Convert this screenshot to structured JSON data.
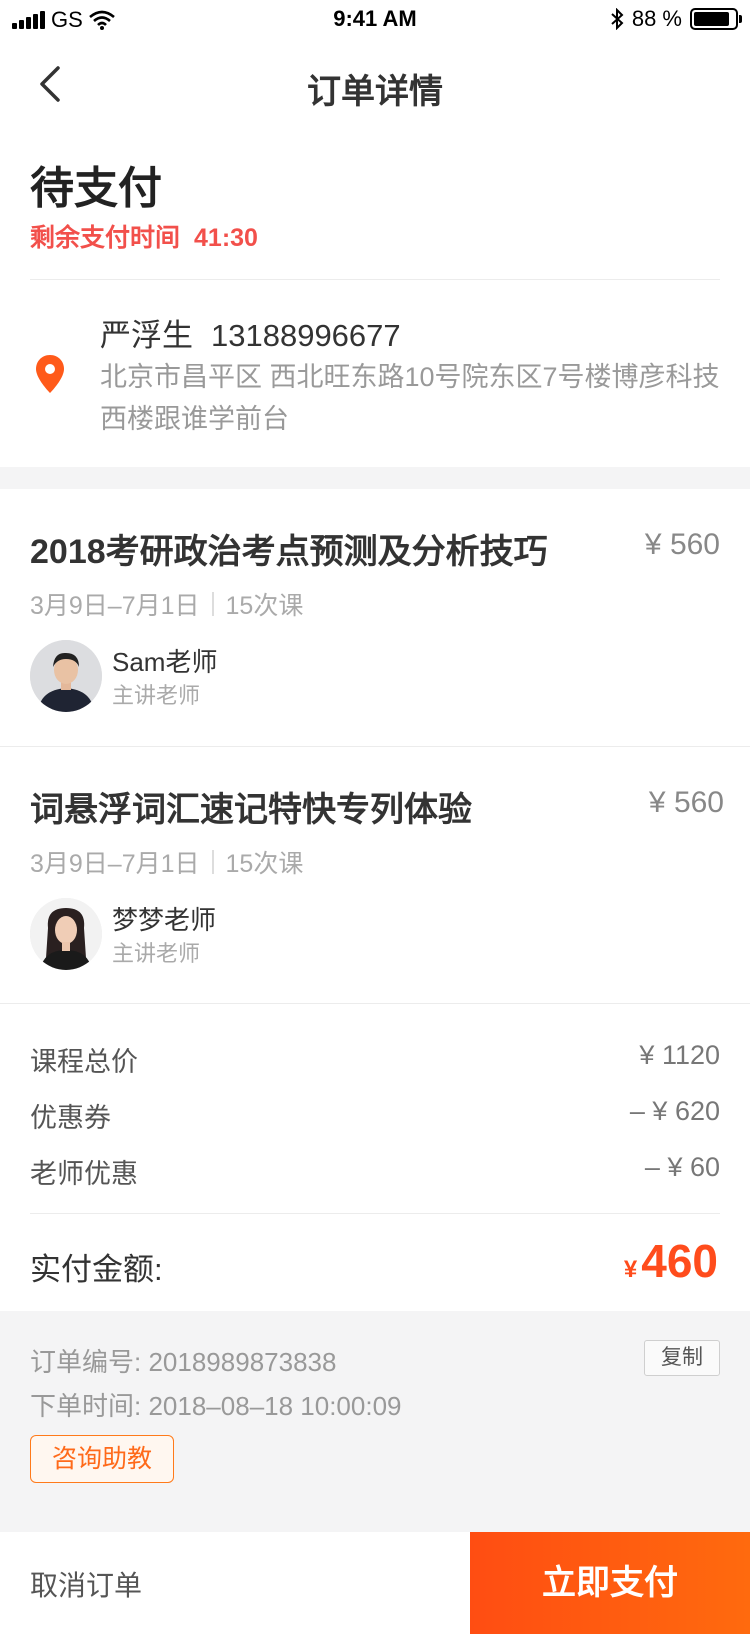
{
  "status_bar": {
    "carrier": "GS",
    "time": "9:41 AM",
    "battery": "88 %",
    "battery_level": 0.88
  },
  "nav": {
    "title": "订单详情"
  },
  "order": {
    "status": "待支付",
    "countdown_label": "剩余支付时间",
    "countdown_time": "41:30"
  },
  "address": {
    "name": "严浮生",
    "phone": "13188996677",
    "detail": "北京市昌平区 西北旺东路10号院东区7号楼博彦科技西楼跟谁学前台"
  },
  "courses": [
    {
      "title": "2018考研政治考点预测及分析技巧",
      "price": "¥ 560",
      "dates": "3月9日–7月1日",
      "lessons": "15次课",
      "teacher": "Sam老师",
      "role": "主讲老师"
    },
    {
      "title": "词悬浮词汇速记特快专列体验",
      "price": "¥ 560",
      "dates": "3月9日–7月1日",
      "lessons": "15次课",
      "teacher": "梦梦老师",
      "role": "主讲老师"
    }
  ],
  "summary": {
    "total_label": "课程总价",
    "total_value": "¥ 1120",
    "coupon_label": "优惠券",
    "coupon_value": "– ¥ 620",
    "teacher_discount_label": "老师优惠",
    "teacher_discount_value": "– ¥ 60",
    "paid_label": "实付金额:",
    "paid_currency": "¥",
    "paid_amount": "460"
  },
  "info": {
    "order_no_label": "订单编号:",
    "order_no": "2018989873838",
    "copy_label": "复制",
    "order_time_label": "下单时间:",
    "order_time": "2018–08–18  10:00:09",
    "consult_label": "咨询助教"
  },
  "actions": {
    "cancel": "取消订单",
    "pay": "立即支付"
  },
  "colors": {
    "accent": "#ff4d12",
    "countdown": "#f2504b",
    "location": "#ff5a1a"
  }
}
